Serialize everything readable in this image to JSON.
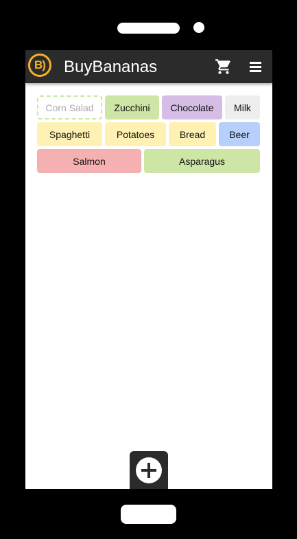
{
  "app": {
    "logo_text": "B)",
    "title": "BuyBananas"
  },
  "icons": {
    "cart": "shopping-cart-icon",
    "menu": "hamburger-menu-icon",
    "add": "plus-icon"
  },
  "colors": {
    "appbar": "#2b2b2b",
    "accent": "#f3b325",
    "green": "#cde6a5",
    "purple": "#d5bde6",
    "grey": "#eeeeee",
    "yellow": "#fff1b3",
    "blue": "#b7cffb",
    "red": "#f5b0b2"
  },
  "items": [
    {
      "label": "Corn Salad",
      "style": "dashed"
    },
    {
      "label": "Zucchini",
      "color": "#cde6a5"
    },
    {
      "label": "Chocolate",
      "color": "#d5bde6"
    },
    {
      "label": "Milk",
      "color": "#eeeeee"
    },
    {
      "label": "Spaghetti",
      "color": "#fff1b3"
    },
    {
      "label": "Potatoes",
      "color": "#fff1b3"
    },
    {
      "label": "Bread",
      "color": "#fff1b3"
    },
    {
      "label": "Beer",
      "color": "#b7cffb"
    },
    {
      "label": "Salmon",
      "color": "#f5b0b2"
    },
    {
      "label": "Asparagus",
      "color": "#cde6a5"
    }
  ]
}
